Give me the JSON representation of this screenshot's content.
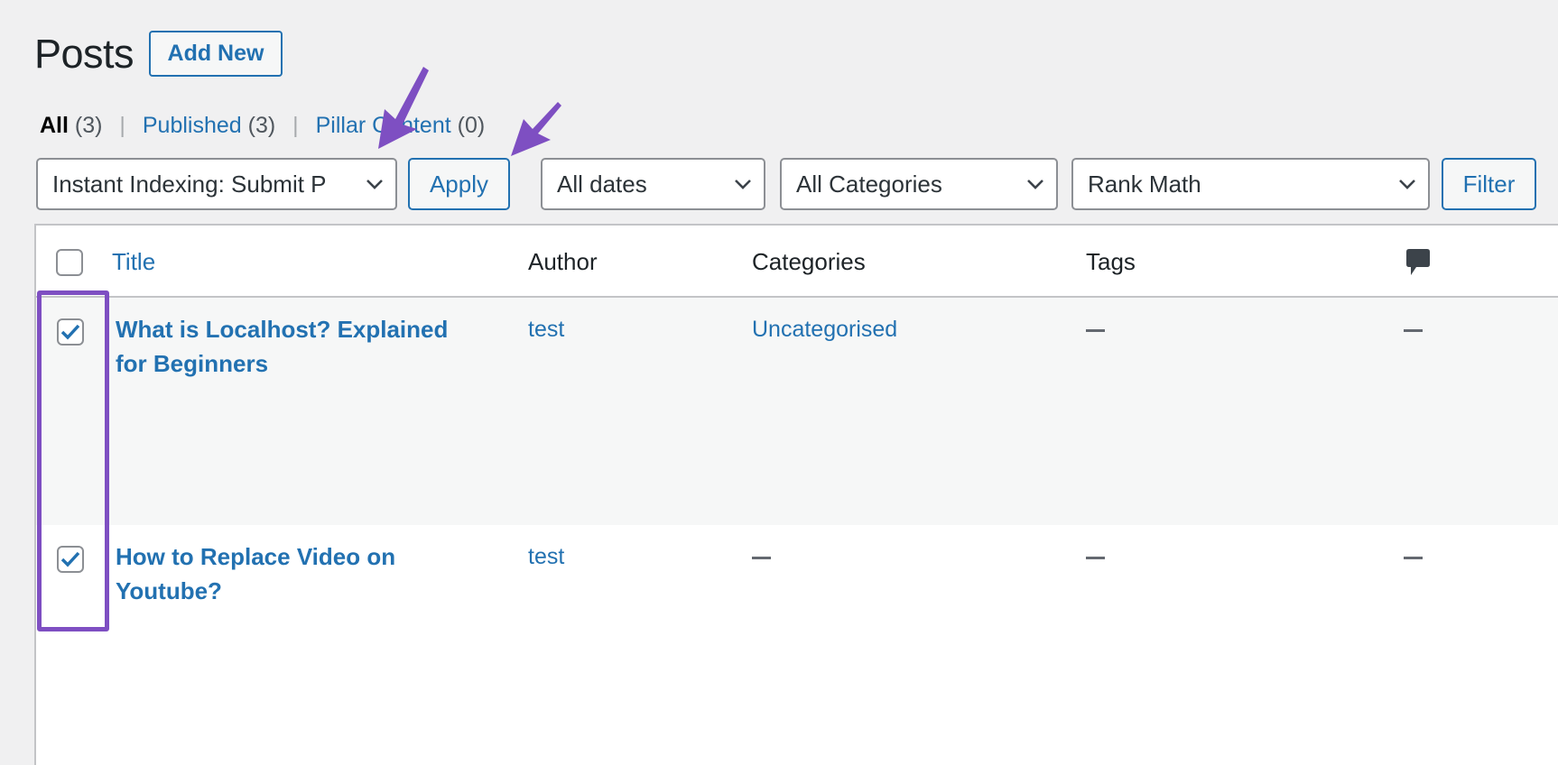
{
  "header": {
    "title": "Posts",
    "add_new_label": "Add New"
  },
  "views": [
    {
      "label": "All",
      "count": "(3)",
      "current": true
    },
    {
      "label": "Published",
      "count": "(3)",
      "current": false
    },
    {
      "label": "Pillar Content",
      "count": "(0)",
      "current": false
    }
  ],
  "views_separator": "|",
  "toolbar": {
    "bulk_action_value": "Instant Indexing: Submit P",
    "apply_label": "Apply",
    "date_filter_value": "All dates",
    "category_filter_value": "All Categories",
    "seo_filter_value": "Rank Math",
    "filter_label": "Filter"
  },
  "table": {
    "columns": {
      "title": "Title",
      "author": "Author",
      "categories": "Categories",
      "tags": "Tags",
      "comments_icon": "comment-bubble-icon"
    },
    "select_all_checked": false,
    "rows": [
      {
        "checked": true,
        "title_line1": "What is Localhost? Explained",
        "title_line2": "for Beginners",
        "author": "test",
        "categories": "Uncategorised",
        "tags": "—",
        "comments": "—"
      },
      {
        "checked": true,
        "title_line1": "How to Replace Video on",
        "title_line2": "Youtube?",
        "author": "test",
        "categories": "—",
        "tags": "—",
        "comments": "—"
      }
    ]
  },
  "annotations": {
    "highlight_color": "#7e4fc2",
    "arrows": [
      "arrow-to-bulk-action",
      "arrow-to-apply-button"
    ]
  },
  "colors": {
    "accent": "#2271b1",
    "background": "#f0f0f1",
    "text": "#1d2327"
  }
}
